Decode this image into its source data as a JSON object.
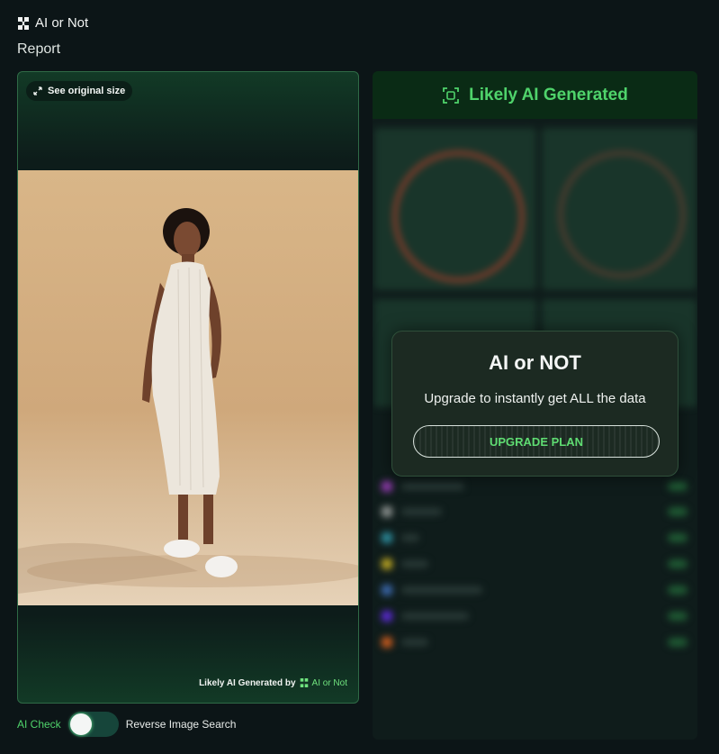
{
  "app": {
    "name": "AI or Not",
    "page_title": "Report"
  },
  "image_panel": {
    "see_original_label": "See original size",
    "credit_prefix": "Likely AI Generated by",
    "credit_brand": "AI or Not"
  },
  "result": {
    "verdict": "Likely AI Generated"
  },
  "upsell": {
    "title": "AI or NOT",
    "subtitle": "Upgrade to instantly get ALL the data",
    "button": "UPGRADE PLAN"
  },
  "mode_toggle": {
    "left_label": "AI Check",
    "right_label": "Reverse Image Search"
  },
  "colors": {
    "accent": "#4fd36b",
    "background": "#0c1517",
    "verdict_bar": "#0a2b15"
  }
}
